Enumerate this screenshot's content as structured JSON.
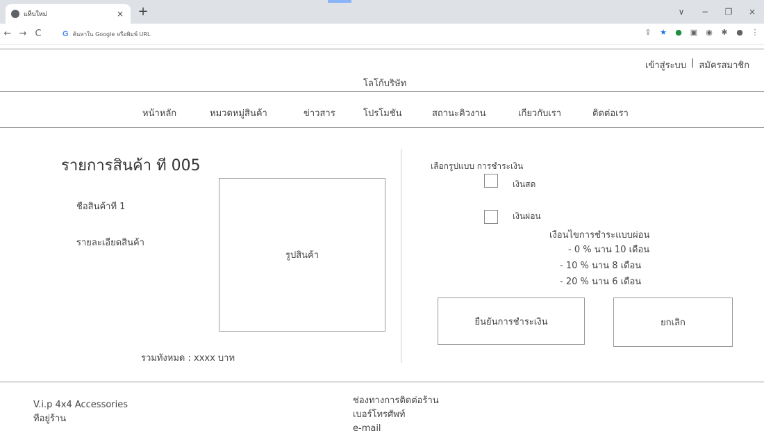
{
  "browser": {
    "tab_title": "แท็บใหม่",
    "tab_close": "×",
    "new_tab": "+",
    "address_placeholder": "ค้นหาใน Google หรือพิมพ์ URL",
    "window_controls": [
      "∨",
      "−",
      "❐",
      "×"
    ]
  },
  "header": {
    "logo": "โลโก้บริษัท",
    "login": "เข้าสู่ระบบ",
    "separator": "|",
    "register": "สมัครสมาชิก"
  },
  "nav": {
    "items": [
      "หน้าหลัก",
      "หมวดหมู่สินค้า",
      "ข่าวสาร",
      "โปรโมชัน",
      "สถานะคิวงาน",
      "เกียวกับเรา",
      "ติดต่อเรา"
    ]
  },
  "product": {
    "title": "รายการสินค้า ที 005",
    "name": "ชือสินค้าที 1",
    "detail": "รายละเอียดสินค้า",
    "image_label": "รูปสินค้า",
    "total": "รวมทังหมด : xxxx บาท"
  },
  "payment": {
    "heading": "เลือกรูปแบบ การชำระเงิน",
    "cash": "เงินสด",
    "installment": "เงินผ่อน",
    "conditions_title": "เงือนไขการชำระแบบผ่อน",
    "conditions": [
      "- 0 % นาน 10 เดือน",
      "- 10 % นาน  8 เดือน",
      "- 20 % นาน 6 เดือน"
    ],
    "confirm": "ยืนยันการชำระเงิน",
    "cancel": "ยกเลิก"
  },
  "footer": {
    "shop_name": "V.i.p 4x4 Accessories",
    "address": "ทีอยู่ร้าน",
    "contact_title": "ช่องทางการติดต่อร้าน",
    "phone": "เบอร์โทรศัพท์",
    "email": "e-mail"
  }
}
